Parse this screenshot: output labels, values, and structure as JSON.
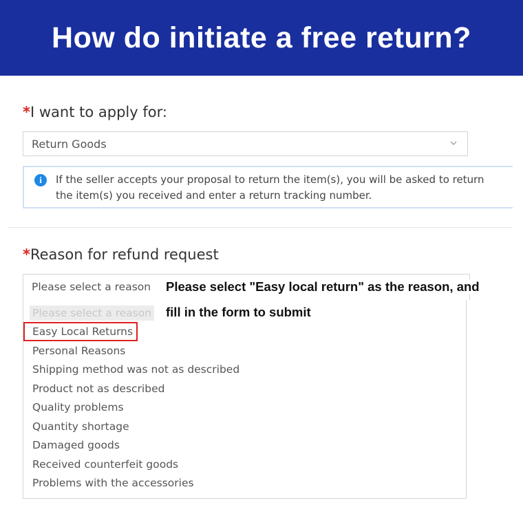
{
  "banner": {
    "title": "How do initiate a free return?"
  },
  "apply": {
    "required_mark": "*",
    "label": "I want to apply for:",
    "selected": "Return Goods",
    "chevron_icon": "chevron-down-icon"
  },
  "notice": {
    "icon": "info-icon",
    "icon_glyph": "i",
    "line1": "If the seller accepts your proposal to return the item(s), you will be asked to return",
    "line2": "the item(s) you received and enter a return tracking number."
  },
  "reason": {
    "required_mark": "*",
    "label": "Reason for refund request",
    "placeholder": "Please select a reason",
    "options": [
      "Please select a reason",
      "Easy Local Returns",
      "Personal Reasons",
      "Shipping method was not as described",
      "Product not as described",
      "Quality problems",
      "Quantity shortage",
      "Damaged goods",
      "Received counterfeit goods",
      "Problems with the accessories"
    ],
    "highlighted_option": "Easy Local Returns"
  },
  "annotation": {
    "line1": "Please select \"Easy local return\" as the reason, and",
    "line2": "fill in the form to submit"
  },
  "colors": {
    "banner": "#1a2f9e",
    "required": "#d9261c",
    "highlight": "#e02020",
    "info": "#1e88e5"
  }
}
